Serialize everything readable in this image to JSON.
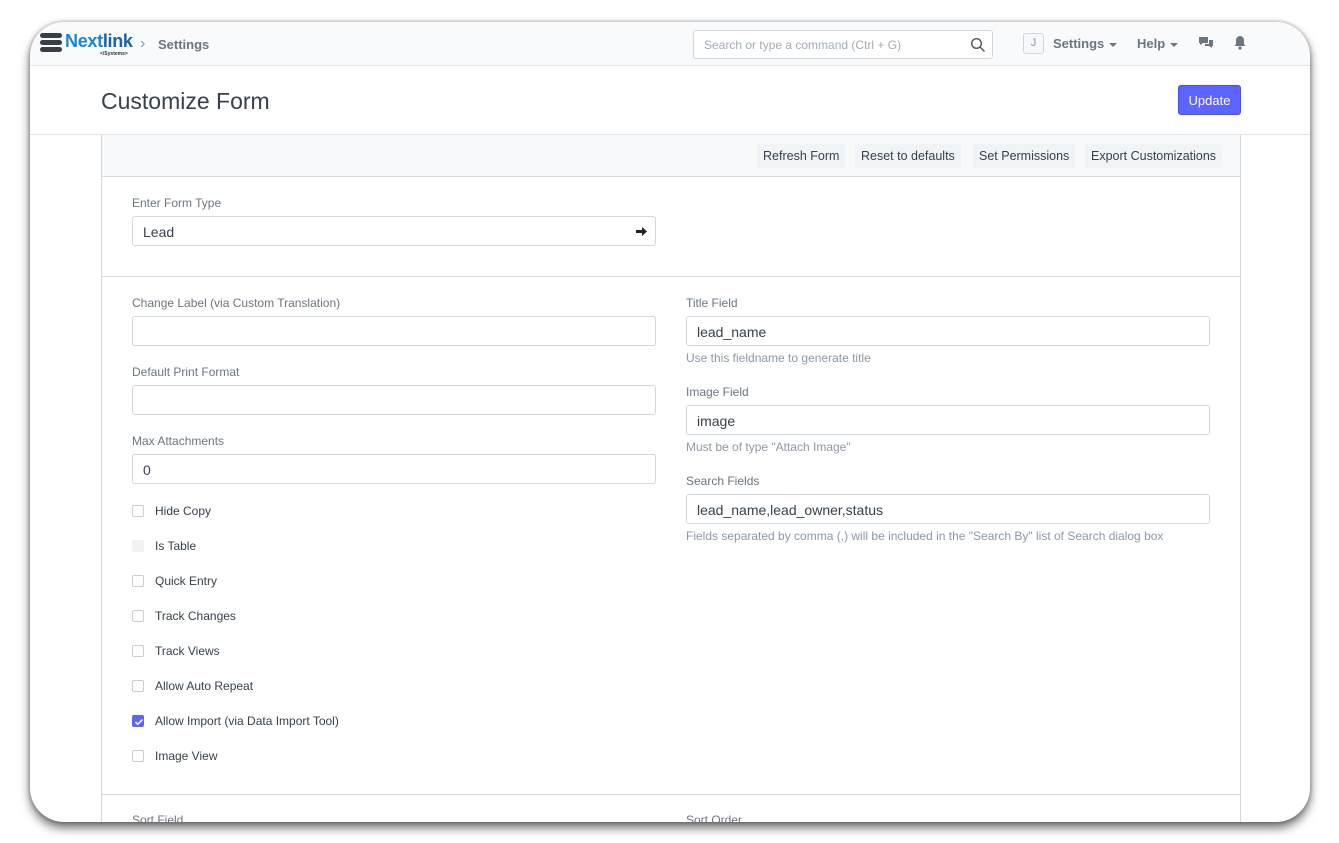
{
  "navbar": {
    "logo_text_a": "Next",
    "logo_text_b": "link",
    "logo_sub": "</Systems>",
    "breadcrumb": "Settings",
    "search_placeholder": "Search or type a command (Ctrl + G)",
    "avatar_initial": "J",
    "settings_label": "Settings",
    "help_label": "Help"
  },
  "page": {
    "title": "Customize Form",
    "update_label": "Update"
  },
  "toolbar": {
    "refresh": "Refresh Form",
    "reset": "Reset to defaults",
    "permissions": "Set Permissions",
    "export": "Export Customizations"
  },
  "form_type": {
    "label": "Enter Form Type",
    "value": "Lead"
  },
  "left": {
    "change_label": {
      "label": "Change Label (via Custom Translation)",
      "value": ""
    },
    "print_format": {
      "label": "Default Print Format",
      "value": ""
    },
    "max_attachments": {
      "label": "Max Attachments",
      "value": "0"
    },
    "checkboxes": [
      {
        "label": "Hide Copy",
        "checked": false,
        "disabled": false
      },
      {
        "label": "Is Table",
        "checked": false,
        "disabled": true
      },
      {
        "label": "Quick Entry",
        "checked": false,
        "disabled": false
      },
      {
        "label": "Track Changes",
        "checked": false,
        "disabled": false
      },
      {
        "label": "Track Views",
        "checked": false,
        "disabled": false
      },
      {
        "label": "Allow Auto Repeat",
        "checked": false,
        "disabled": false
      },
      {
        "label": "Allow Import (via Data Import Tool)",
        "checked": true,
        "disabled": false
      },
      {
        "label": "Image View",
        "checked": false,
        "disabled": false
      }
    ]
  },
  "right": {
    "title_field": {
      "label": "Title Field",
      "value": "lead_name",
      "help": "Use this fieldname to generate title"
    },
    "image_field": {
      "label": "Image Field",
      "value": "image",
      "help": "Must be of type \"Attach Image\""
    },
    "search_fields": {
      "label": "Search Fields",
      "value": "lead_name,lead_owner,status",
      "help": "Fields separated by comma (,) will be included in the \"Search By\" list of Search dialog box"
    }
  },
  "next_section": {
    "sort_field": "Sort Field",
    "sort_order": "Sort Order"
  },
  "colors": {
    "primary": "#5e64ff",
    "logo_blue": "#1a86d6"
  }
}
